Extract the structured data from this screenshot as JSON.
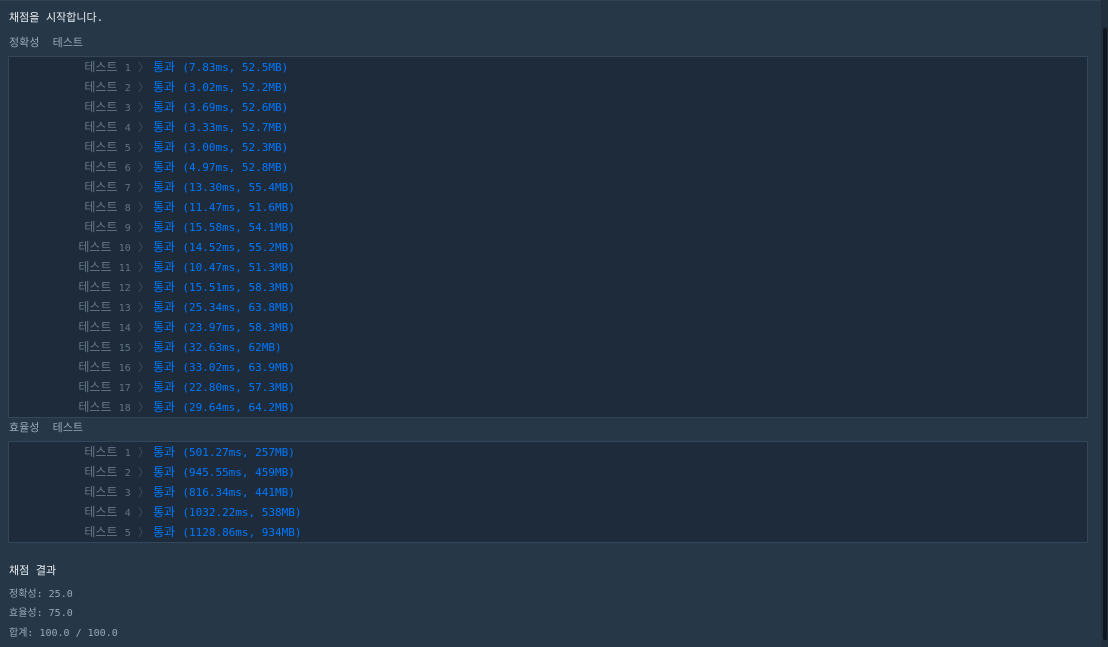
{
  "console": {
    "start_message": "채점을 시작합니다.",
    "accuracy_section_label": "정확성  테스트",
    "efficiency_section_label": "효율성  테스트",
    "test_word": "테스트",
    "separator": "〉",
    "accuracy_tests": [
      {
        "num": "1",
        "result": "통과",
        "detail": "(7.83ms, 52.5MB)"
      },
      {
        "num": "2",
        "result": "통과",
        "detail": "(3.02ms, 52.2MB)"
      },
      {
        "num": "3",
        "result": "통과",
        "detail": "(3.69ms, 52.6MB)"
      },
      {
        "num": "4",
        "result": "통과",
        "detail": "(3.33ms, 52.7MB)"
      },
      {
        "num": "5",
        "result": "통과",
        "detail": "(3.00ms, 52.3MB)"
      },
      {
        "num": "6",
        "result": "통과",
        "detail": "(4.97ms, 52.8MB)"
      },
      {
        "num": "7",
        "result": "통과",
        "detail": "(13.30ms, 55.4MB)"
      },
      {
        "num": "8",
        "result": "통과",
        "detail": "(11.47ms, 51.6MB)"
      },
      {
        "num": "9",
        "result": "통과",
        "detail": "(15.58ms, 54.1MB)"
      },
      {
        "num": "10",
        "result": "통과",
        "detail": "(14.52ms, 55.2MB)"
      },
      {
        "num": "11",
        "result": "통과",
        "detail": "(10.47ms, 51.3MB)"
      },
      {
        "num": "12",
        "result": "통과",
        "detail": "(15.51ms, 58.3MB)"
      },
      {
        "num": "13",
        "result": "통과",
        "detail": "(25.34ms, 63.8MB)"
      },
      {
        "num": "14",
        "result": "통과",
        "detail": "(23.97ms, 58.3MB)"
      },
      {
        "num": "15",
        "result": "통과",
        "detail": "(32.63ms, 62MB)"
      },
      {
        "num": "16",
        "result": "통과",
        "detail": "(33.02ms, 63.9MB)"
      },
      {
        "num": "17",
        "result": "통과",
        "detail": "(22.80ms, 57.3MB)"
      },
      {
        "num": "18",
        "result": "통과",
        "detail": "(29.64ms, 64.2MB)"
      }
    ],
    "efficiency_tests": [
      {
        "num": "1",
        "result": "통과",
        "detail": "(501.27ms, 257MB)"
      },
      {
        "num": "2",
        "result": "통과",
        "detail": "(945.55ms, 459MB)"
      },
      {
        "num": "3",
        "result": "통과",
        "detail": "(816.34ms, 441MB)"
      },
      {
        "num": "4",
        "result": "통과",
        "detail": "(1032.22ms, 538MB)"
      },
      {
        "num": "5",
        "result": "통과",
        "detail": "(1128.86ms, 934MB)"
      }
    ],
    "result_title": "채점 결과",
    "scores": [
      {
        "label": "정확성",
        "value": "25.0"
      },
      {
        "label": "효율성",
        "value": "75.0"
      },
      {
        "label": "합계",
        "value": "100.0 / 100.0"
      }
    ]
  },
  "colors": {
    "background": "#263747",
    "panel": "#1e2b3a",
    "pass": "#0078ff",
    "muted": "#667788"
  }
}
